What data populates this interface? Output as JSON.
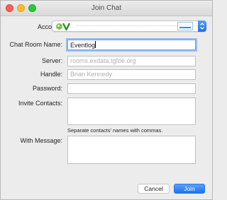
{
  "window": {
    "title": "Join Chat"
  },
  "account": {
    "label": "Account:"
  },
  "form": {
    "room_label": "Chat Room Name:",
    "room_value": "Eventlog",
    "server_label": "Server:",
    "server_placeholder": "rooms.exdata.tgfoe.org",
    "handle_label": "Handle:",
    "handle_placeholder": "Brian Kennedy",
    "password_label": "Password:",
    "password_value": "",
    "invite_label": "Invite Contacts:",
    "invite_hint": "Separate contacts' names with commas.",
    "message_label": "With Message:"
  },
  "buttons": {
    "cancel": "Cancel",
    "join": "Join"
  },
  "colors": {
    "accent": "#1b72f6",
    "focus_ring": "#97bff3",
    "close": "#fc5f57",
    "minimize": "#fdbc2e",
    "zoom": "#28c840"
  },
  "icons": [
    "close-button",
    "minimize-button",
    "zoom-button",
    "account-service-logo",
    "popup-stepper-icon"
  ]
}
